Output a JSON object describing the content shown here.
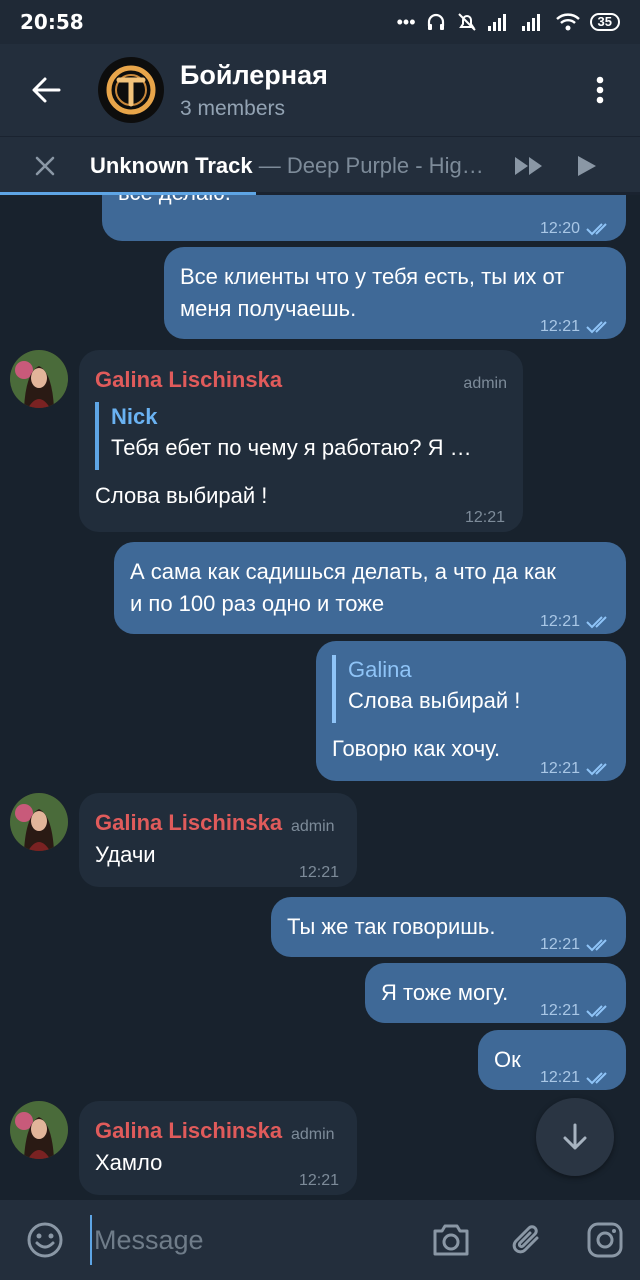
{
  "status": {
    "time": "20:58",
    "battery": "35"
  },
  "header": {
    "title": "Бойлерная",
    "subtitle": "3 members"
  },
  "player": {
    "track": "Unknown Track",
    "separator": " — ",
    "artist": "Deep Purple - Hig…",
    "progress": 0.4
  },
  "messages": {
    "m1": {
      "text": "все делаю.",
      "time": "12:20"
    },
    "m2": {
      "line1": "Все клиенты что у тебя есть, ты их от",
      "line2": "меня получаешь.",
      "time": "12:21"
    },
    "m3": {
      "sender": "Galina Lischinska",
      "role": "admin",
      "reply_name": "Nick",
      "reply_text": "Тебя ебет по чему я работаю? Я …",
      "text": "Слова выбирай !",
      "time": "12:21"
    },
    "m4": {
      "line1": "А сама как садишься делать, а что да как",
      "line2": "и по 100 раз одно и тоже",
      "time": "12:21"
    },
    "m5": {
      "reply_name": "Galina",
      "reply_text": "Слова выбирай !",
      "text": "Говорю как хочу.",
      "time": "12:21"
    },
    "m6": {
      "sender": "Galina Lischinska",
      "role": "admin",
      "text": "Удачи",
      "time": "12:21"
    },
    "m7": {
      "text": "Ты же так говоришь.",
      "time": "12:21"
    },
    "m8": {
      "text": "Я тоже могу.",
      "time": "12:21"
    },
    "m9": {
      "text": "Ок",
      "time": "12:21"
    },
    "m10": {
      "sender": "Galina Lischinska",
      "role": "admin",
      "text": "Хамло",
      "time": "12:21"
    }
  },
  "input": {
    "placeholder": "Message"
  },
  "icons": {
    "back": "arrow-left-icon",
    "menu": "more-vert-icon",
    "close": "close-icon",
    "next": "fast-forward-icon",
    "play": "play-icon",
    "scroll": "arrow-down-icon",
    "emoji": "emoji-icon",
    "camera": "camera-icon",
    "attach": "paperclip-icon",
    "instagram": "instagram-icon"
  },
  "colors": {
    "background": "#18222d",
    "header": "#232e3c",
    "outgoing": "#3f6997",
    "incoming": "#212d3b",
    "accent": "#5ea5e5",
    "sender": "#e05b5b"
  }
}
